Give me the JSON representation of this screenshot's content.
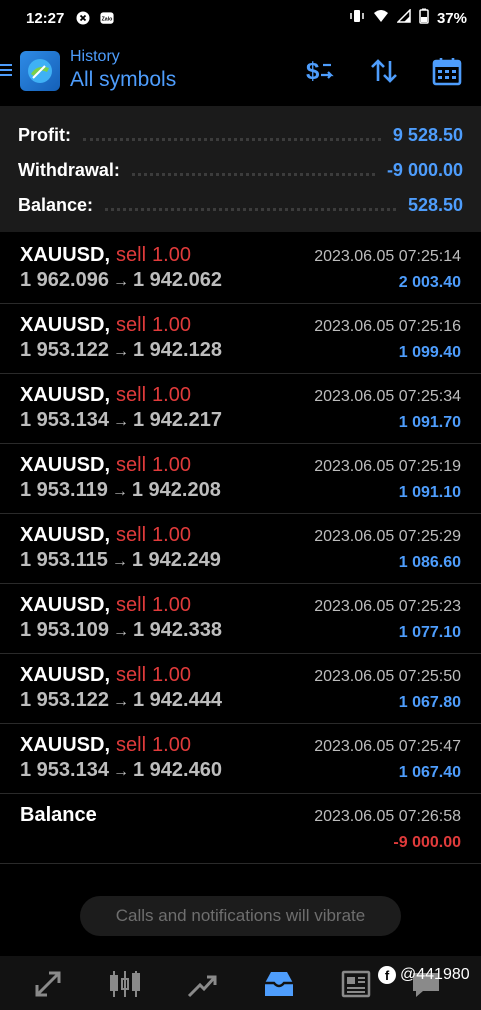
{
  "statusbar": {
    "time": "12:27",
    "battery": "37%",
    "icons": [
      "notification-x-icon",
      "zalo-icon",
      "vibrate-icon",
      "wifi-icon",
      "signal-icon",
      "battery-icon"
    ],
    "zalo_label": "Zalo"
  },
  "header": {
    "subtitle": "History",
    "title": "All symbols",
    "icons": [
      "menu-icon",
      "app-logo-icon",
      "dollar-exchange-icon",
      "sort-icon",
      "calendar-icon"
    ]
  },
  "summary": {
    "profit_label": "Profit:",
    "profit_value": "9 528.50",
    "withdrawal_label": "Withdrawal:",
    "withdrawal_value": "-9 000.00",
    "balance_label": "Balance:",
    "balance_value": "528.50"
  },
  "deals": [
    {
      "symbol": "XAUUSD,",
      "side": "sell",
      "volume": "1.00",
      "open": "1 962.096",
      "close": "1 942.062",
      "time": "2023.06.05 07:25:14",
      "profit": "2 003.40"
    },
    {
      "symbol": "XAUUSD,",
      "side": "sell",
      "volume": "1.00",
      "open": "1 953.122",
      "close": "1 942.128",
      "time": "2023.06.05 07:25:16",
      "profit": "1 099.40"
    },
    {
      "symbol": "XAUUSD,",
      "side": "sell",
      "volume": "1.00",
      "open": "1 953.134",
      "close": "1 942.217",
      "time": "2023.06.05 07:25:34",
      "profit": "1 091.70"
    },
    {
      "symbol": "XAUUSD,",
      "side": "sell",
      "volume": "1.00",
      "open": "1 953.119",
      "close": "1 942.208",
      "time": "2023.06.05 07:25:19",
      "profit": "1 091.10"
    },
    {
      "symbol": "XAUUSD,",
      "side": "sell",
      "volume": "1.00",
      "open": "1 953.115",
      "close": "1 942.249",
      "time": "2023.06.05 07:25:29",
      "profit": "1 086.60"
    },
    {
      "symbol": "XAUUSD,",
      "side": "sell",
      "volume": "1.00",
      "open": "1 953.109",
      "close": "1 942.338",
      "time": "2023.06.05 07:25:23",
      "profit": "1 077.10"
    },
    {
      "symbol": "XAUUSD,",
      "side": "sell",
      "volume": "1.00",
      "open": "1 953.122",
      "close": "1 942.444",
      "time": "2023.06.05 07:25:50",
      "profit": "1 067.80"
    },
    {
      "symbol": "XAUUSD,",
      "side": "sell",
      "volume": "1.00",
      "open": "1 953.134",
      "close": "1 942.460",
      "time": "2023.06.05 07:25:47",
      "profit": "1 067.40"
    }
  ],
  "balance_row": {
    "label": "Balance",
    "time": "2023.06.05 07:26:58",
    "value": "-9 000.00"
  },
  "arrow": "→",
  "toast": "Calls and notifications will vibrate",
  "bottom_nav": {
    "items": [
      "quotes-icon",
      "chart-icon",
      "trade-icon",
      "history-icon",
      "news-icon",
      "messages-icon"
    ],
    "active": "history-icon"
  },
  "watermark": {
    "fb": "f",
    "text": "@441980"
  },
  "colors": {
    "accent": "#4e9dfc",
    "sell": "#e03b3b",
    "background": "#000000",
    "summary_bg": "#1b1b1b"
  }
}
